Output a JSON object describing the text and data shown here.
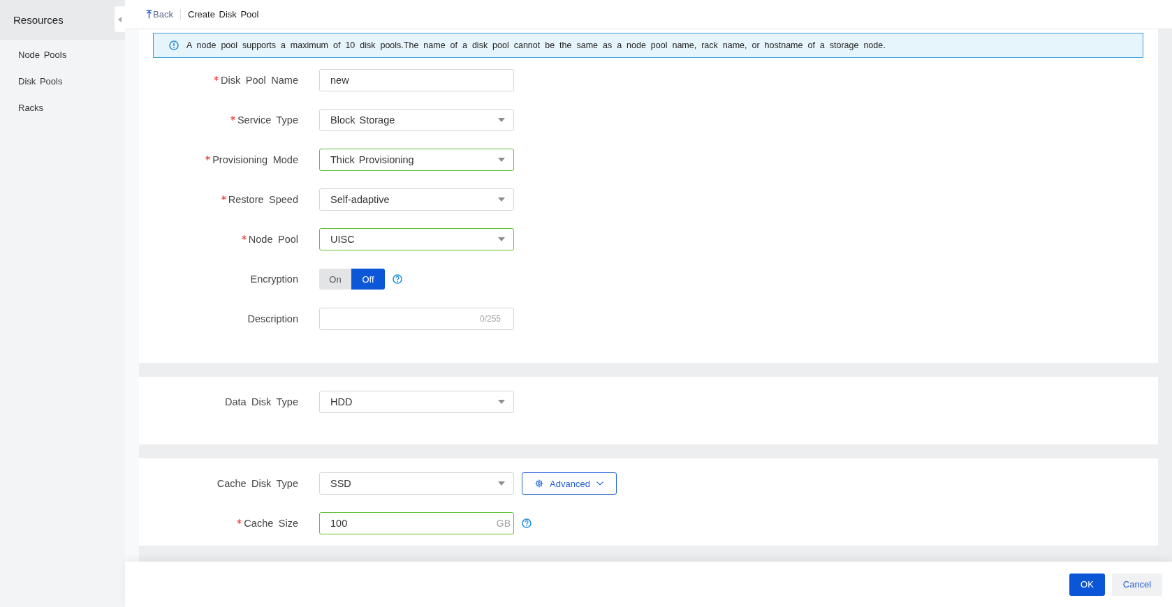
{
  "sidebar": {
    "title": "Resources",
    "items": [
      {
        "label": "Node Pools",
        "selected": false
      },
      {
        "label": "Disk Pools",
        "selected": false
      },
      {
        "label": "Racks",
        "selected": false
      }
    ]
  },
  "header": {
    "back": "Back",
    "title": "Create Disk Pool"
  },
  "notice": "A node pool supports a maximum of 10 disk pools.The name of a disk pool cannot be the same as a node pool name, rack name, or hostname of a storage node.",
  "sections": [
    {
      "fields": [
        {
          "kind": "text",
          "label": "Disk Pool Name",
          "required": true,
          "validated": false,
          "value": "new"
        },
        {
          "kind": "select",
          "label": "Service Type",
          "required": true,
          "validated": false,
          "value": "Block Storage"
        },
        {
          "kind": "select",
          "label": "Provisioning Mode",
          "required": true,
          "validated": true,
          "value": "Thick Provisioning"
        },
        {
          "kind": "select",
          "label": "Restore Speed",
          "required": true,
          "validated": false,
          "value": "Self-adaptive"
        },
        {
          "kind": "select",
          "label": "Node Pool",
          "required": true,
          "validated": true,
          "value": "UISC"
        },
        {
          "kind": "toggle",
          "label": "Encryption",
          "required": false,
          "help": true,
          "options": [
            {
              "label": "On",
              "selected": false
            },
            {
              "label": "Off",
              "selected": true
            }
          ]
        },
        {
          "kind": "text",
          "label": "Description",
          "required": false,
          "validated": false,
          "counter": "0/255"
        }
      ]
    },
    {
      "fields": [
        {
          "kind": "select",
          "label": "Data Disk Type",
          "required": false,
          "validated": false,
          "value": "HDD"
        }
      ]
    },
    {
      "fields": [
        {
          "kind": "select",
          "label": "Cache Disk Type",
          "required": false,
          "validated": false,
          "value": "SSD",
          "action": {
            "label": "Advanced"
          }
        },
        {
          "kind": "text",
          "label": "Cache Size",
          "required": true,
          "validated": true,
          "value": "100",
          "unit": "GB",
          "help": true
        }
      ]
    }
  ],
  "footer": {
    "buttons": [
      {
        "label": "OK",
        "kind": "primary"
      },
      {
        "label": "Cancel",
        "kind": "secondary"
      }
    ]
  }
}
